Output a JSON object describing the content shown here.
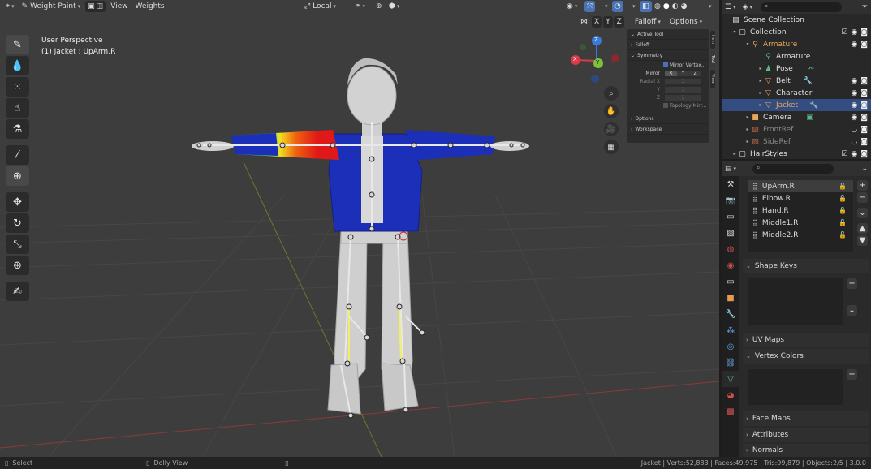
{
  "header": {
    "mode": "Weight Paint",
    "menu": [
      "View",
      "Weights"
    ],
    "orientation": "Local",
    "falloff": "Falloff",
    "options": "Options",
    "axes": [
      "X",
      "Y",
      "Z"
    ]
  },
  "viewport": {
    "perspective": "User Perspective",
    "object_info": "(1) Jacket : UpArm.R"
  },
  "gizmo": {
    "x": "X",
    "y": "Y",
    "z": "Z"
  },
  "npanel": {
    "active_tool": "Active Tool",
    "falloff": "Falloff",
    "symmetry": "Symmetry",
    "mirror_vertex": "Mirror Vertex...",
    "mirror": "Mirror",
    "mx": "X",
    "my": "Y",
    "mz": "Z",
    "radial_x": "Radial X",
    "radial_y": "Y",
    "radial_z": "Z",
    "radial_val": "1",
    "topology_mirror": "Topology Mirr...",
    "options": "Options",
    "workspace": "Workspace",
    "tabs": [
      "Item",
      "Tool",
      "View"
    ]
  },
  "outliner": {
    "items": [
      {
        "label": "Scene Collection",
        "indent": 0,
        "icon": "scene-collection-icon"
      },
      {
        "label": "Collection",
        "indent": 1,
        "icon": "collection-icon"
      },
      {
        "label": "Armature",
        "indent": 2,
        "icon": "armature-icon",
        "color": "#e8a65a"
      },
      {
        "label": "Armature",
        "indent": 3,
        "icon": "armature-data-icon"
      },
      {
        "label": "Pose",
        "indent": 3,
        "icon": "pose-icon"
      },
      {
        "label": "Belt",
        "indent": 3,
        "icon": "mesh-icon"
      },
      {
        "label": "Character",
        "indent": 3,
        "icon": "mesh-icon"
      },
      {
        "label": "Jacket",
        "indent": 3,
        "icon": "mesh-icon",
        "color": "#e8a65a"
      },
      {
        "label": "Camera",
        "indent": 2,
        "icon": "camera-icon"
      },
      {
        "label": "FrontRef",
        "indent": 2,
        "icon": "image-icon",
        "color": "#8a8a8a"
      },
      {
        "label": "SideRef",
        "indent": 2,
        "icon": "image-icon",
        "color": "#8a8a8a"
      },
      {
        "label": "HairStyles",
        "indent": 1,
        "icon": "collection-icon"
      }
    ]
  },
  "properties": {
    "bones": [
      "UpArm.R",
      "Elbow.R",
      "Hand.R",
      "Middle1.R",
      "Middle2.R"
    ],
    "sections": [
      "Shape Keys",
      "UV Maps",
      "Vertex Colors",
      "Face Maps",
      "Attributes",
      "Normals"
    ]
  },
  "status": {
    "select": "Select",
    "dolly": "Dolly View",
    "stats": "Jacket | Verts:52,883 | Faces:49,975 | Tris:99,879 | Objects:2/5 | 3.0.0"
  }
}
